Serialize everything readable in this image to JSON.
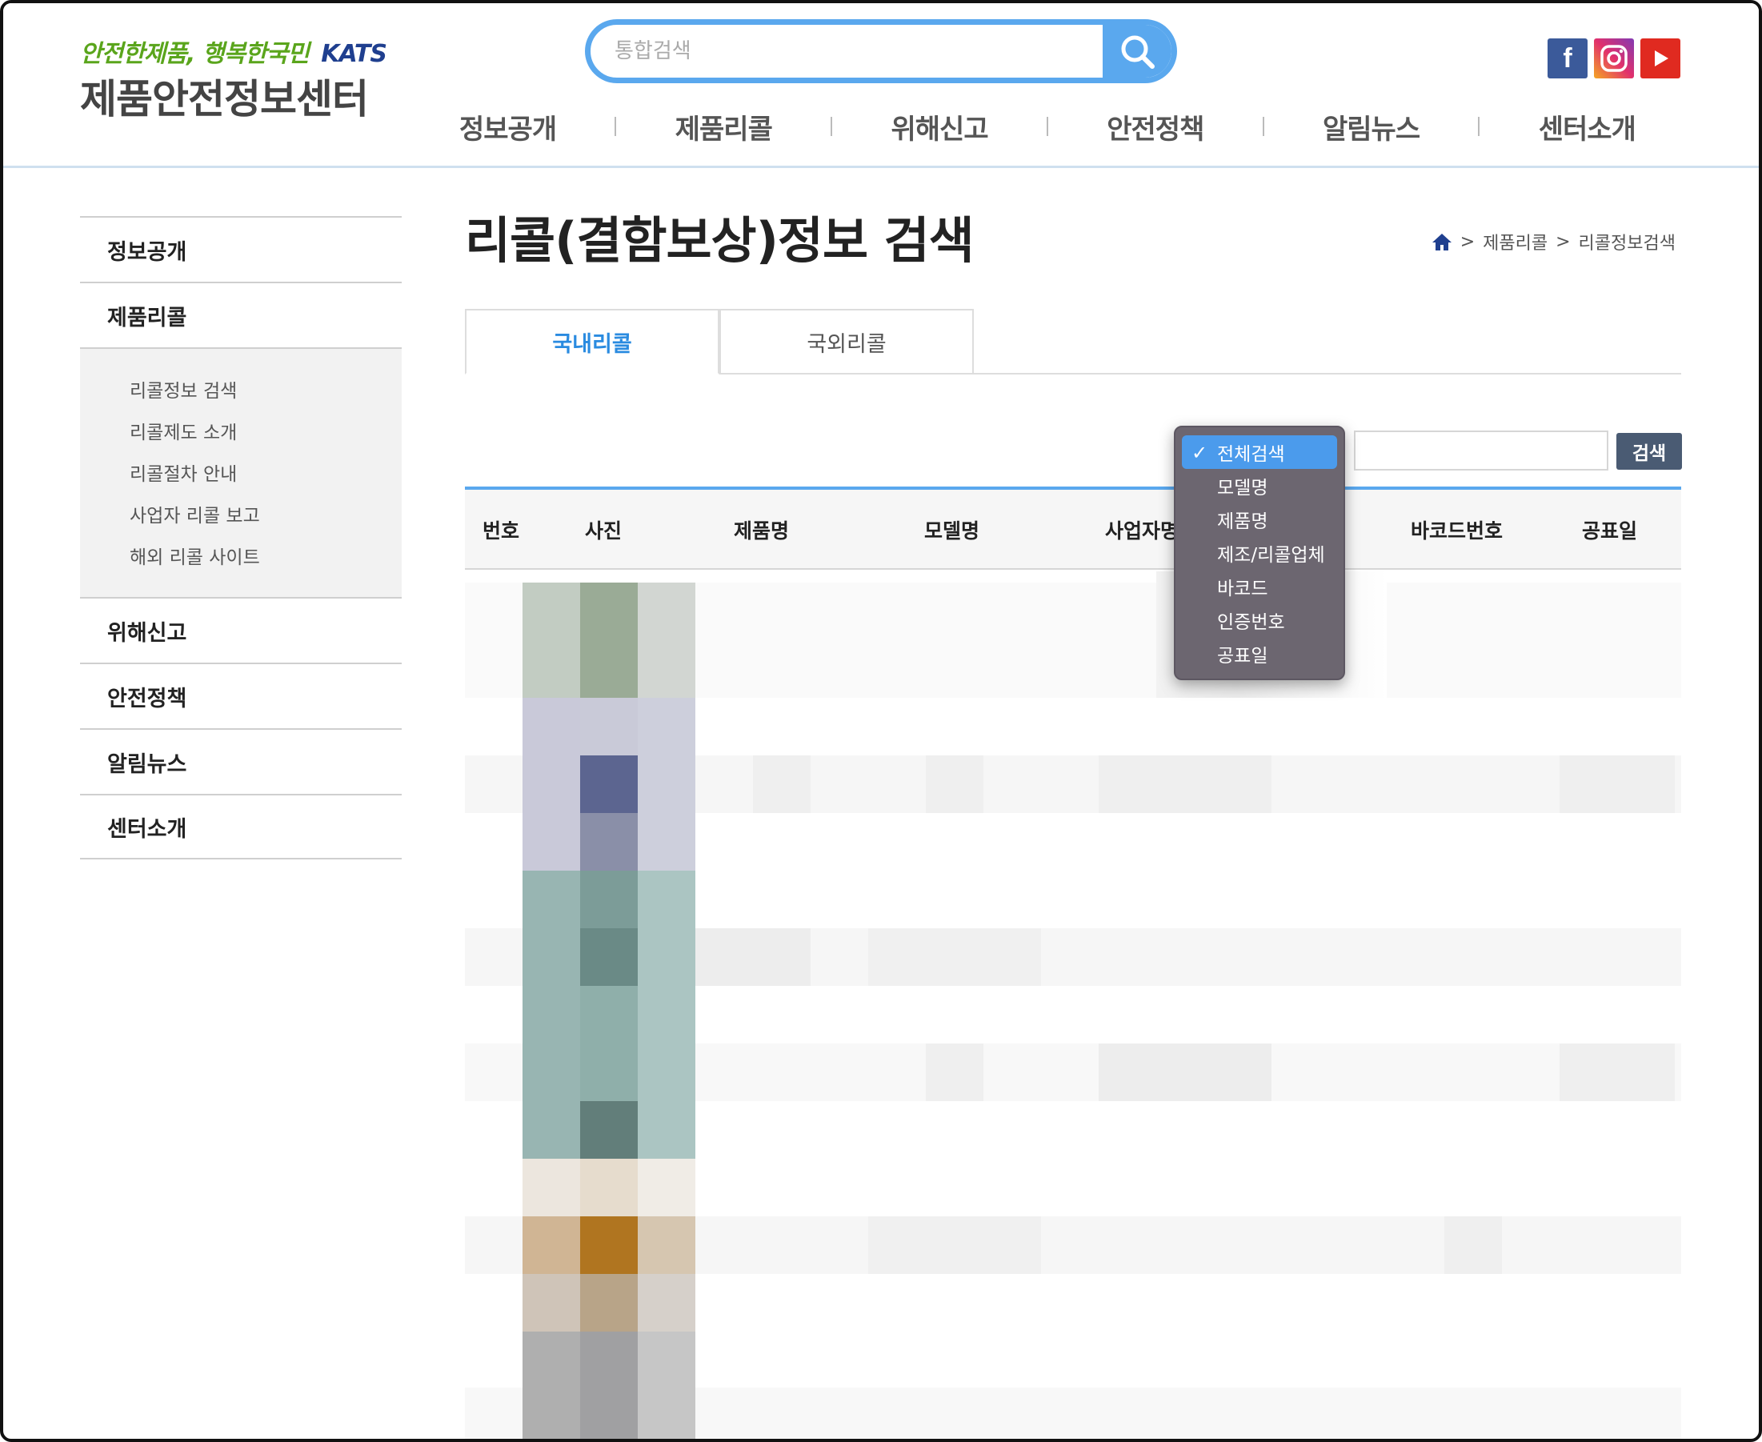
{
  "header": {
    "slogan": "안전한제품, 행복한국민",
    "org_logo": "KATS",
    "site_title": "제품안전정보센터",
    "search": {
      "placeholder": "통합검색",
      "icon": "search-icon"
    },
    "social": [
      {
        "name": "facebook",
        "icon": "facebook-icon",
        "glyph": "f",
        "color": "#3b5a9a"
      },
      {
        "name": "instagram",
        "icon": "instagram-icon",
        "color": "#e1306c"
      },
      {
        "name": "youtube",
        "icon": "youtube-icon",
        "color": "#e02a20"
      }
    ],
    "nav": [
      "정보공개",
      "제품리콜",
      "위해신고",
      "안전정책",
      "알림뉴스",
      "센터소개"
    ]
  },
  "sidebar": {
    "items": [
      {
        "label": "정보공개"
      },
      {
        "label": "제품리콜"
      },
      {
        "label": "위해신고"
      },
      {
        "label": "안전정책"
      },
      {
        "label": "알림뉴스"
      },
      {
        "label": "센터소개"
      }
    ],
    "sub_items": [
      "리콜정보 검색",
      "리콜제도 소개",
      "리콜절차 안내",
      "사업자 리콜 보고",
      "해외 리콜 사이트"
    ]
  },
  "main": {
    "title": "리콜(결함보상)정보 검색",
    "breadcrumb": {
      "home_icon": "home-icon",
      "sep": ">",
      "level1": "제품리콜",
      "level2": "리콜정보검색"
    },
    "tabs": [
      {
        "label": "국내리콜",
        "active": true
      },
      {
        "label": "국외리콜",
        "active": false
      }
    ],
    "search_button": "검색",
    "search_field_value": "",
    "dropdown": {
      "selected": "전체검색",
      "options": [
        "전체검색",
        "모델명",
        "제품명",
        "제조/리콜업체",
        "바코드",
        "인증번호",
        "공표일"
      ]
    },
    "table": {
      "columns": [
        "번호",
        "사진",
        "제품명",
        "모델명",
        "사업자명",
        "바코드번호",
        "공표일"
      ]
    }
  },
  "colors": {
    "accent": "#5aa8ee",
    "tab_active": "#2a8be0",
    "button_dark": "#4a5b73",
    "dropdown_bg": "#6c6670"
  }
}
